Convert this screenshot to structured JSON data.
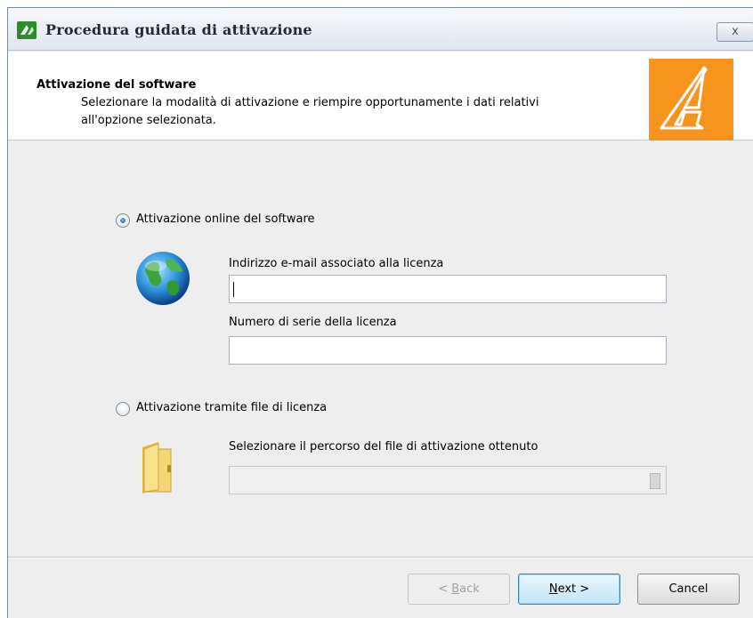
{
  "window": {
    "title": "Procedura guidata di attivazione",
    "close_label": "x"
  },
  "header": {
    "title": "Attivazione del software",
    "subtitle_line1": "Selezionare la modalità di attivazione e riempire opportunamente i dati relativi",
    "subtitle_line2": "all'opzione selezionata.",
    "brand_color": "#f7941d"
  },
  "online": {
    "radio_label": "Attivazione online del software",
    "selected": true,
    "icon": "globe-icon",
    "email_label": "Indirizzo e-mail associato alla licenza",
    "email_value": "",
    "serial_label": "Numero di serie della licenza",
    "serial_value": ""
  },
  "file": {
    "radio_label": "Attivazione tramite file di licenza",
    "selected": false,
    "icon": "folder-icon",
    "path_label": "Selezionare il percorso del file di attivazione ottenuto",
    "path_value": ""
  },
  "buttons": {
    "back_pre": "< ",
    "back_u": "B",
    "back_post": "ack",
    "next_u": "N",
    "next_post": "ext >",
    "cancel": "Cancel"
  }
}
